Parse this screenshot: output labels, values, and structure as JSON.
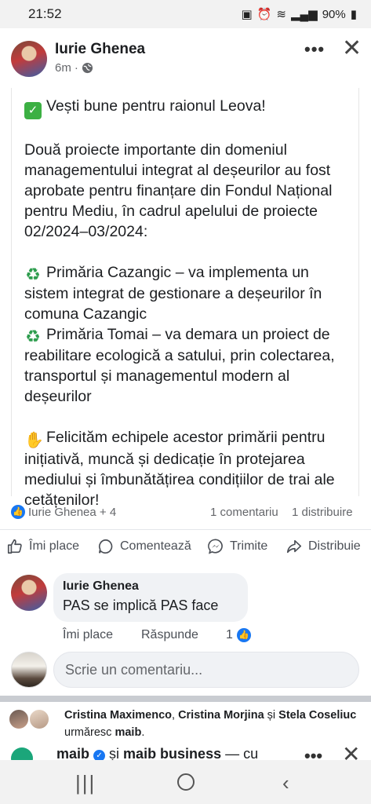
{
  "status": {
    "time": "21:52",
    "battery": "90%"
  },
  "post": {
    "author": "Iurie Ghenea",
    "time": "6m",
    "more": "•••",
    "close": "✕",
    "lines": [
      "Vești bune pentru raionul Leova!",
      "Două proiecte importante din domeniul managementului integrat al deșeurilor au fost aprobate pentru finanțare din Fondul Național pentru Mediu, în cadrul apelului de proiecte 02/2024–03/2024:",
      "Primăria Cazangic – va implementa un sistem integrat de gestionare a deșeurilor în comuna Cazangic",
      "Primăria Tomai – va demara un proiect de reabilitare ecologică a satului, prin colectarea, transportul și managementul modern al deșeurilor",
      "Felicităm echipele acestor primării pentru inițiativă, muncă și dedicație în protejarea mediului și îmbunătățirea condițiilor de trai ale cetățenilor!"
    ],
    "reactors": "Iurie Ghenea + 4",
    "comments_count": "1 comentariu",
    "shares_count": "1 distribuire"
  },
  "actions": {
    "like": "Îmi place",
    "comment": "Comentează",
    "send": "Trimite",
    "share": "Distribuie"
  },
  "comment": {
    "author": "Iurie Ghenea",
    "text": "PAS se implică PAS face",
    "like": "Îmi place",
    "reply": "Răspunde",
    "reactions": "1"
  },
  "composer": {
    "placeholder": "Scrie un comentariu..."
  },
  "next_post": {
    "followers_a": "Cristina Maximenco",
    "followers_b": "Cristina Morjina",
    "followers_and": " și ",
    "followers_c": "Stela Coseliuc",
    "follows_verb": " urmăresc ",
    "followed": "maib",
    "page_a": "maib",
    "and": " și ",
    "page_b": "maib business",
    "suffix": " — cu"
  }
}
